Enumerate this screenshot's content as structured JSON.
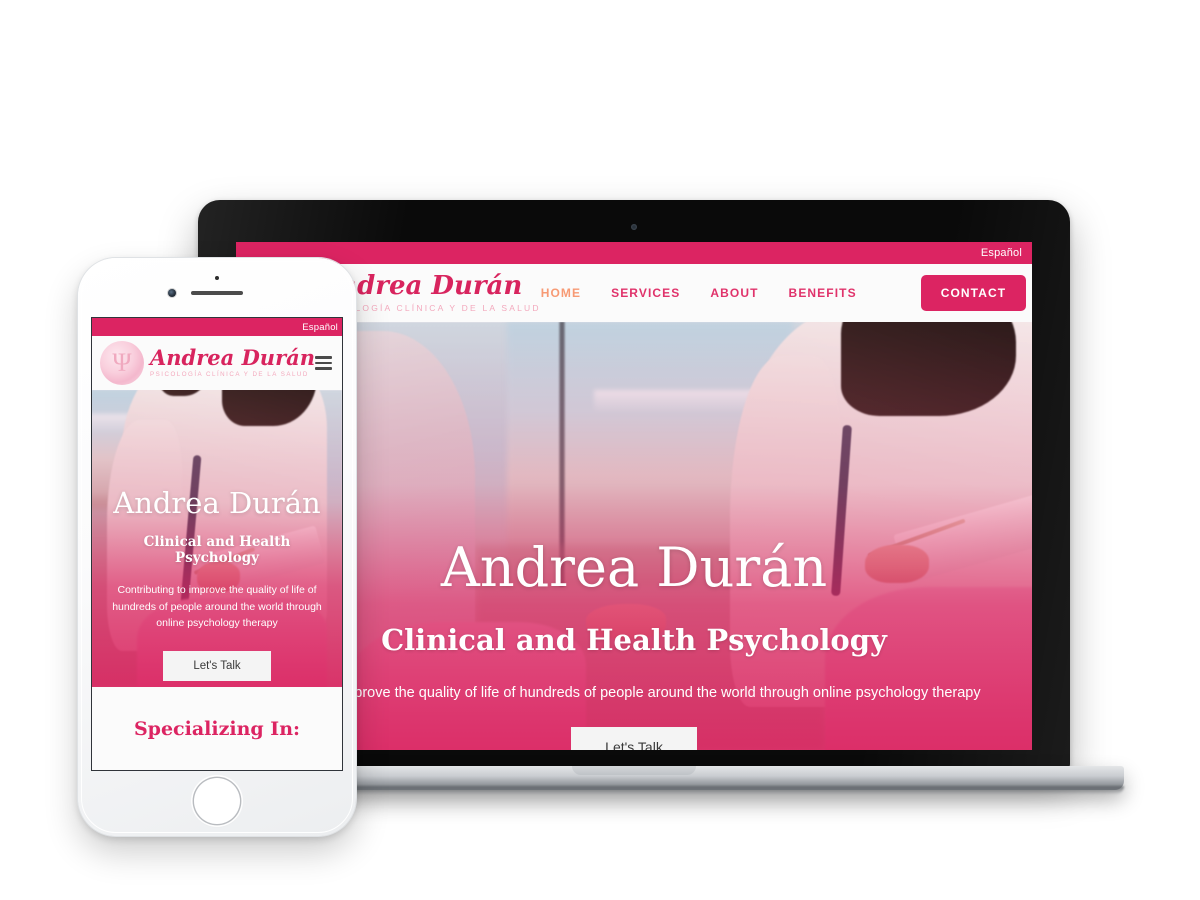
{
  "device_mockup": {
    "laptop_label": "laptop-device-mockup",
    "phone_label": "phone-device-mockup"
  },
  "site": {
    "topbar": {
      "language_label": "Español"
    },
    "brand": {
      "name": "Andrea Durán",
      "subtitle": "PSICOLOGÍA CLÍNICA Y DE LA SALUD",
      "badge_glyph": "Ψ"
    },
    "nav": {
      "links": [
        {
          "label": "HOME",
          "active": true
        },
        {
          "label": "SERVICES",
          "active": false
        },
        {
          "label": "ABOUT",
          "active": false
        },
        {
          "label": "BENEFITS",
          "active": false
        }
      ],
      "cta_label": "CONTACT"
    },
    "hero": {
      "title": "Andrea Durán",
      "subtitle": "Clinical and Health Psychology",
      "tagline": "Contributing to improve the quality of life of hundreds of people around the world through online psychology therapy",
      "tagline_clipped": "uting to improve the quality of life of hundreds of people around the world through online psychology therapy",
      "button_label": "Let's Talk"
    },
    "sections": {
      "specializing_title": "Specializing In:"
    }
  },
  "colors": {
    "brand_pink": "#dc2462",
    "brand_pink_text": "#e0336b",
    "nav_active": "#f79a74",
    "brand_sub_pink": "#f3a9bd",
    "hero_overlay": "#dd2361",
    "button_light": "#f4f4f4",
    "page_background": "#ffffff"
  }
}
